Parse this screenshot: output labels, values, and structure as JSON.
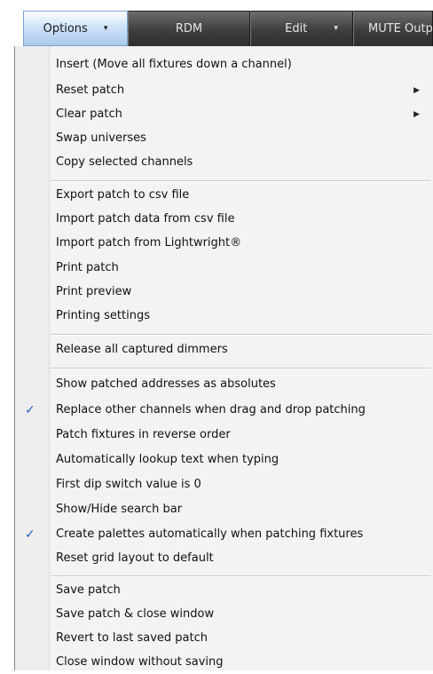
{
  "toolbar": {
    "tabs": [
      {
        "label": "Options",
        "has_dropdown": true,
        "active": true
      },
      {
        "label": "RDM",
        "has_dropdown": false,
        "active": false
      },
      {
        "label": "Edit",
        "has_dropdown": true,
        "active": false
      },
      {
        "label": "MUTE Outp",
        "has_dropdown": false,
        "active": false
      }
    ],
    "dropdown_glyph": "▾"
  },
  "menu": {
    "check_glyph": "✓",
    "submenu_glyph": "▶",
    "items": [
      {
        "label": "Insert (Move all fixtures down  a channel)"
      },
      {
        "label": "Reset patch",
        "submenu": true
      },
      {
        "label": "Clear patch",
        "submenu": true
      },
      {
        "label": "Swap universes"
      },
      {
        "label": "Copy selected channels"
      },
      {
        "label": "Export patch to csv file"
      },
      {
        "label": "Import patch data from csv file"
      },
      {
        "label": "Import patch from Lightwright®"
      },
      {
        "label": "Print patch"
      },
      {
        "label": "Print preview"
      },
      {
        "label": "Printing settings"
      },
      {
        "label": "Release all captured dimmers"
      },
      {
        "label": "Show patched addresses as absolutes"
      },
      {
        "label": "Replace other channels when drag and drop patching",
        "checked": true
      },
      {
        "label": "Patch fixtures in reverse order"
      },
      {
        "label": "Automatically lookup text when typing"
      },
      {
        "label": "First dip switch value is 0"
      },
      {
        "label": "Show/Hide search bar"
      },
      {
        "label": "Create palettes automatically when patching fixtures",
        "checked": true
      },
      {
        "label": "Reset grid layout to default"
      },
      {
        "label": "Save patch"
      },
      {
        "label": "Save patch & close window"
      },
      {
        "label": "Revert to last saved patch"
      },
      {
        "label": "Close window without saving"
      }
    ]
  }
}
